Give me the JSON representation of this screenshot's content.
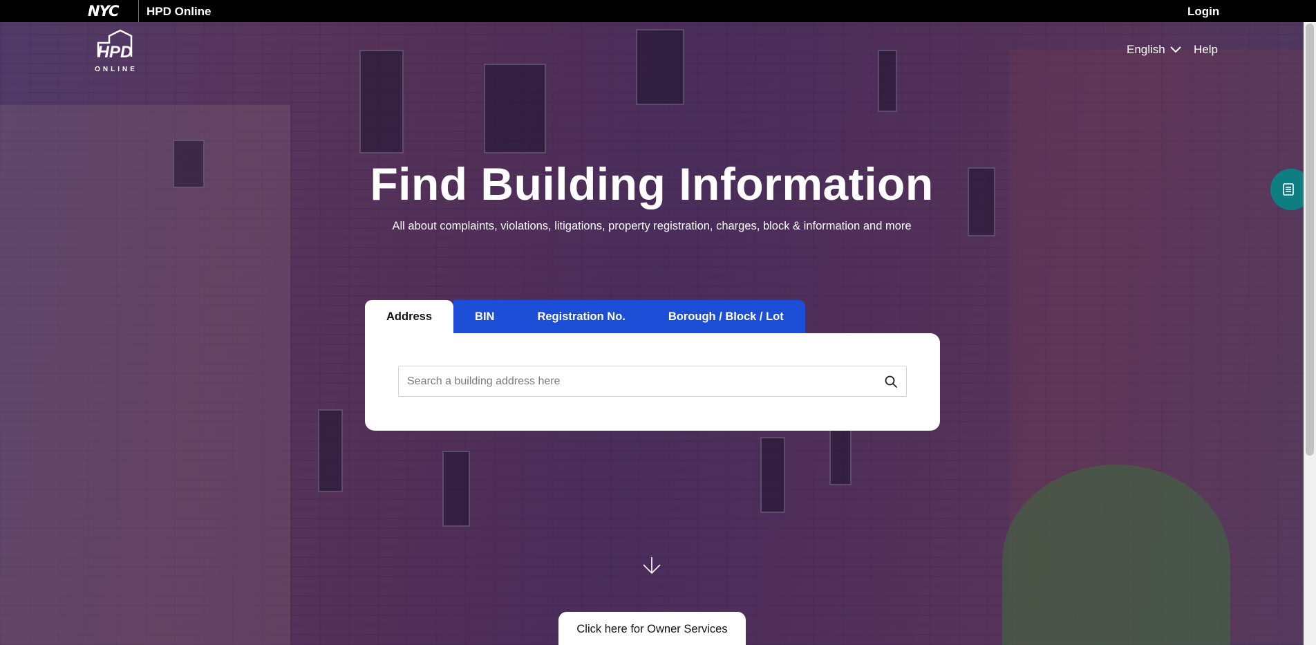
{
  "topbar": {
    "logo": "NYC",
    "site_name": "HPD Online",
    "login": "Login"
  },
  "header": {
    "logo_text": "HPD",
    "logo_subtext": "ONLINE",
    "language": "English",
    "help": "Help"
  },
  "hero": {
    "title": "Find Building Information",
    "subtitle": "All about complaints, violations, litigations, property registration, charges, block & information and more"
  },
  "search": {
    "tabs": [
      {
        "label": "Address",
        "active": true
      },
      {
        "label": "BIN",
        "active": false
      },
      {
        "label": "Registration No.",
        "active": false
      },
      {
        "label": "Borough / Block / Lot",
        "active": false
      }
    ],
    "placeholder": "Search a building address here",
    "value": ""
  },
  "owner_services": {
    "label": "Click here for Owner Services"
  },
  "colors": {
    "tab_blue": "#1d4ed8",
    "side_tab_teal": "#0e7e82",
    "overlay_purple": "#3a2260"
  },
  "icons": {
    "search": "search-icon",
    "language_dropdown": "chevron-down-icon",
    "side_tab": "document-list-icon",
    "scroll_down": "arrow-down-icon"
  }
}
